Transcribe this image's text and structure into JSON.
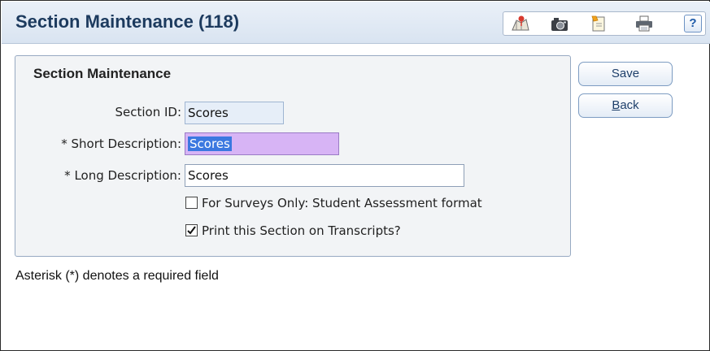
{
  "header": {
    "title": "Section Maintenance (118)",
    "toolbar_icons": [
      "map-pin-icon",
      "camera-icon",
      "notes-icon",
      "printer-icon",
      "help-icon"
    ],
    "help_label": "?"
  },
  "panel": {
    "title": "Section Maintenance",
    "fields": {
      "section_id": {
        "label": "Section ID:",
        "value": "Scores"
      },
      "short_description": {
        "label": "* Short Description:",
        "value": "Scores"
      },
      "long_description": {
        "label": "* Long Description:",
        "value": "Scores"
      }
    },
    "checkboxes": {
      "surveys_only": {
        "label": "For Surveys Only: Student Assessment format",
        "checked": false
      },
      "print_on_transcripts": {
        "label": "Print this Section on Transcripts?",
        "checked": true
      }
    }
  },
  "actions": {
    "save_label": "Save",
    "back_label_underlined": "B",
    "back_label_rest": "ack"
  },
  "footer": {
    "note": "Asterisk (*) denotes a required field"
  },
  "colors": {
    "title": "#1c3a5e",
    "selection": "#3b78e0",
    "required_highlight": "#d7b4f5"
  }
}
